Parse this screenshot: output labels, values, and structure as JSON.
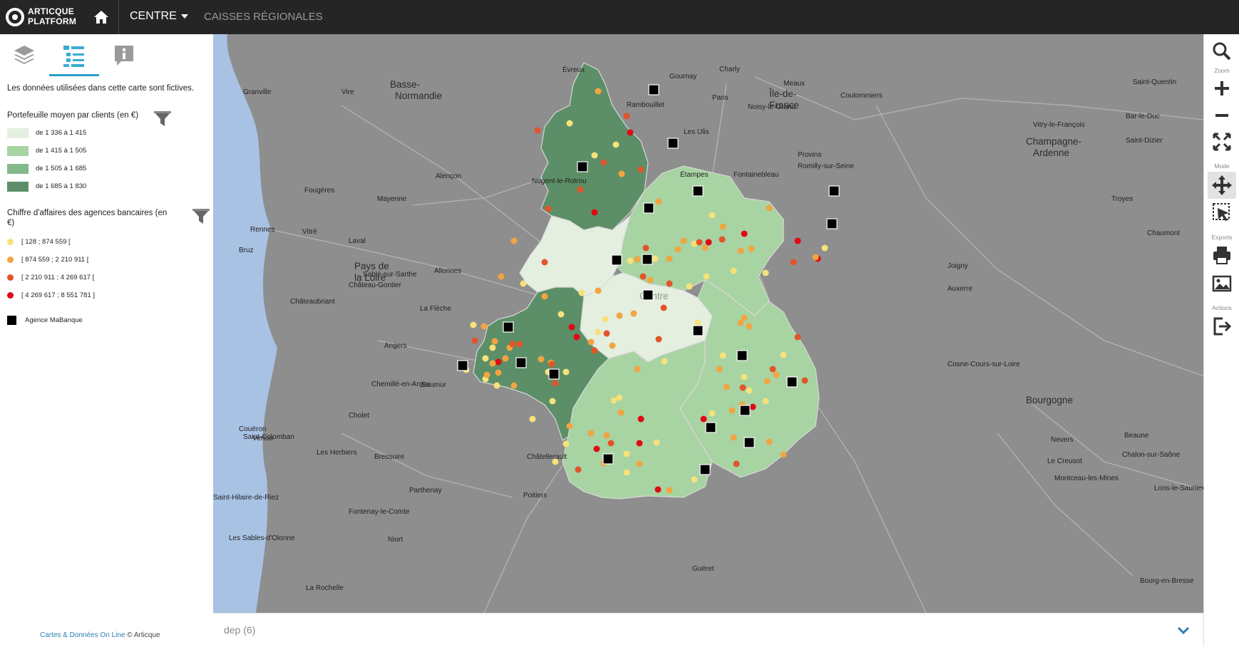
{
  "brand": {
    "line1": "ARTICQUE",
    "line2": "PLATFORM"
  },
  "nav": {
    "region": "CENTRE",
    "caisses": "CAISSES RÉGIONALES"
  },
  "sidebar": {
    "disclaimer": "Les données utilisées dans cette carte sont fictives.",
    "legend1": {
      "title": "Portefeuille moyen par clients (en €)",
      "classes": [
        {
          "label": "de 1 336 à 1 415",
          "color": "#e4efe0"
        },
        {
          "label": "de 1 415 à 1 505",
          "color": "#a8d3a2"
        },
        {
          "label": "de 1 505 à 1 685",
          "color": "#84b989"
        },
        {
          "label": "de 1 685 à 1 830",
          "color": "#5c8f67"
        }
      ]
    },
    "legend2": {
      "title": "Chiffre d'affaires des agences bancaires (en €)",
      "classes": [
        {
          "label": "[ 128 ; 874 559 [",
          "color": "#f6e27a"
        },
        {
          "label": "[ 874 559 ; 2 210 911 [",
          "color": "#f0a540"
        },
        {
          "label": "[ 2 210 911 ; 4 269 617 [",
          "color": "#e2542a"
        },
        {
          "label": "[ 4 269 617 ; 8 551 781 ]",
          "color": "#e00914"
        }
      ]
    },
    "agency_label": "Agence MaBanque",
    "footer": {
      "link": "Cartes & Données On Line",
      "suffix": " © Articque"
    }
  },
  "map": {
    "region_labels": [
      "Basse-",
      "Normandie",
      "Pays de",
      "la Loire",
      "Île-de-",
      "France",
      "Champagne-",
      "Ardenne",
      "Bourgogne",
      "Centre"
    ],
    "places": [
      "Évreux",
      "Granville",
      "Vire",
      "Rambouillet",
      "Paris",
      "Meaux",
      "Vitry-le-François",
      "Bar-le-Duc",
      "Saint-Dizier",
      "Les Ulis",
      "Étampes",
      "Fontainebleau",
      "Provins",
      "Romilly-sur-Seine",
      "Troyes",
      "Alençon",
      "Mayenne",
      "Fougères",
      "Rennes",
      "Vitré",
      "Laval",
      "Bruz",
      "Sablé-sur-Sarthe",
      "Allonnes",
      "Château-Gontier",
      "Châteaubriant",
      "La Flèche",
      "Joigny",
      "Auxerre",
      "Chaumont",
      "Angers",
      "Chemillé-en-Anjou",
      "Saumur",
      "Cholet",
      "Saint-Colomban",
      "Les Herbiers",
      "Bressuire",
      "Châtellerault",
      "Parthenay",
      "Poitiers",
      "Fontenay-le-Comte",
      "Niort",
      "La Rochelle",
      "Nevers",
      "Beaune",
      "Chalon-sur-Saône",
      "Le Creusot",
      "Montceau-les-Mines",
      "Lons-le-Saunier",
      "Bourg-en-Bresse",
      "Guéret",
      "Les Sables-d'Olonne",
      "Saint-Hilaire-de-Riez",
      "Couëron",
      "Vertou",
      "Cosne-Cours-sur-Loire",
      "Nogent-le-Rotrou",
      "Gournay",
      "Saint-Quentin",
      "Noisy-le-Grand",
      "Coulommiers",
      "Charly"
    ]
  },
  "bottombar": {
    "label": "dep (6)"
  },
  "toolbar": {
    "zoom": "Zoom",
    "mode": "Mode",
    "exports": "Exports",
    "actions": "Actions"
  }
}
